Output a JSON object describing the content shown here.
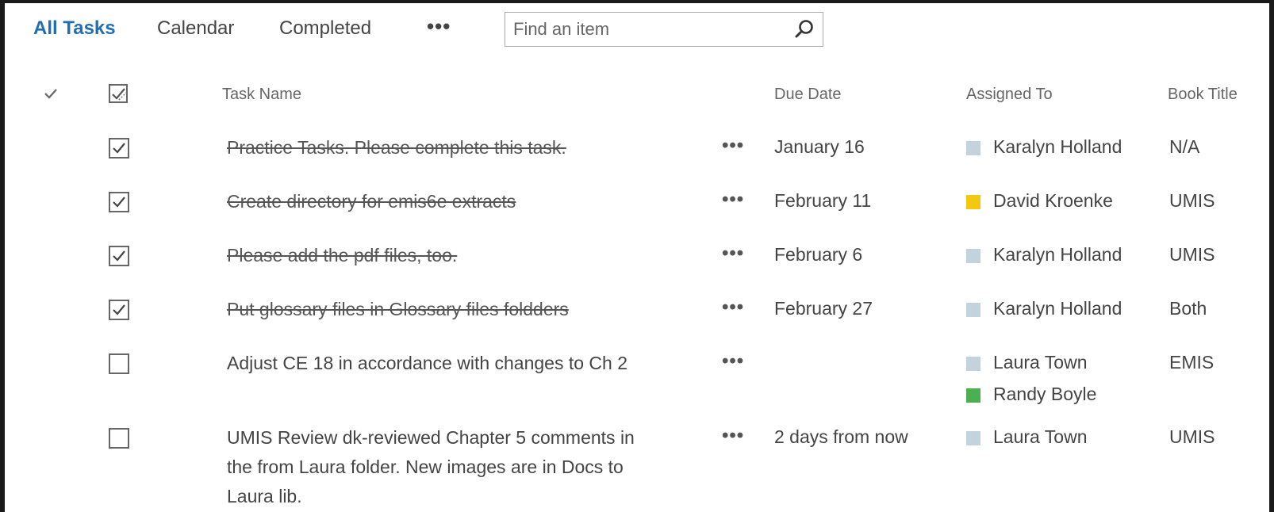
{
  "views": {
    "tabs": [
      "All Tasks",
      "Calendar",
      "Completed"
    ],
    "active_tab": "All Tasks",
    "more_label": "•••"
  },
  "search": {
    "placeholder": "Find an item",
    "value": ""
  },
  "columns": {
    "task_name": "Task Name",
    "due_date": "Due Date",
    "assigned_to": "Assigned To",
    "book_title": "Book Title"
  },
  "row_menu_label": "•••",
  "colors": {
    "accent": "#1f6fb8",
    "presence_gray": "#c3d3dd",
    "presence_yellow": "#f2c811",
    "presence_green": "#4caf50"
  },
  "rows": [
    {
      "completed": true,
      "task": "Practice Tasks. Please complete this task.",
      "due": "January 16",
      "assignees": [
        {
          "name": "Karalyn Holland",
          "status_color": "#c3d3dd"
        }
      ],
      "book": "N/A"
    },
    {
      "completed": true,
      "task": "Create directory for emis6e extracts",
      "due": "February 11",
      "assignees": [
        {
          "name": "David Kroenke",
          "status_color": "#f2c811"
        }
      ],
      "book": "UMIS"
    },
    {
      "completed": true,
      "task": "Please add the pdf files, too.",
      "due": "February 6",
      "assignees": [
        {
          "name": "Karalyn Holland",
          "status_color": "#c3d3dd"
        }
      ],
      "book": "UMIS"
    },
    {
      "completed": true,
      "task": "Put glossary files in Glossary files foldders",
      "due": "February 27",
      "assignees": [
        {
          "name": "Karalyn Holland",
          "status_color": "#c3d3dd"
        }
      ],
      "book": "Both"
    },
    {
      "completed": false,
      "task": "Adjust CE 18 in accordance with changes to Ch 2",
      "due": "",
      "assignees": [
        {
          "name": "Laura Town",
          "status_color": "#c3d3dd"
        },
        {
          "name": "Randy Boyle",
          "status_color": "#4caf50"
        }
      ],
      "book": "EMIS"
    },
    {
      "completed": false,
      "task": "UMIS Review dk-reviewed Chapter 5 comments in the from Laura folder. New images are in Docs to Laura lib.",
      "due": "2 days from now",
      "assignees": [
        {
          "name": "Laura Town",
          "status_color": "#c3d3dd"
        }
      ],
      "book": "UMIS"
    }
  ]
}
